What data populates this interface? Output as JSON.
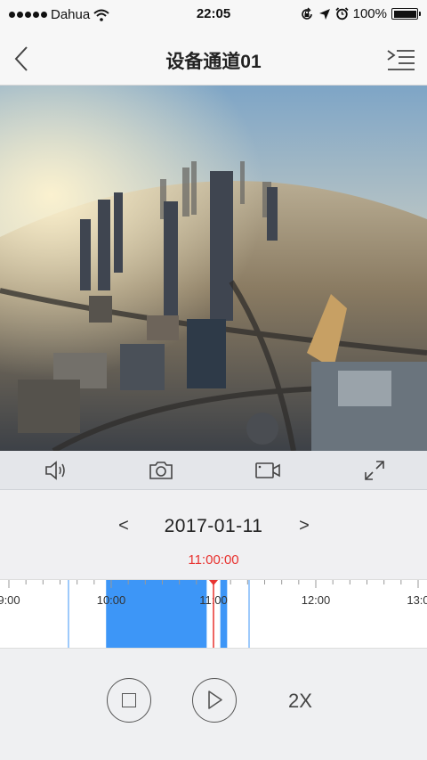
{
  "status_bar": {
    "carrier": "Dahua",
    "time": "22:05",
    "battery": "100%",
    "icons": [
      "signal-dots-icon",
      "wifi-icon",
      "rotation-lock-icon",
      "location-arrow-icon",
      "alarm-icon",
      "battery-icon"
    ]
  },
  "nav": {
    "title": "设备通道01",
    "icons": [
      "back-chevron-icon",
      "channel-list-icon"
    ]
  },
  "video": {
    "scene": "city-aerial-view"
  },
  "controls": {
    "icons": [
      "speaker-icon",
      "camera-icon",
      "record-video-icon",
      "fullscreen-icon"
    ]
  },
  "date": {
    "prev": "<",
    "value": "2017-01-11",
    "next": ">"
  },
  "timeline": {
    "current_time": "11:00:00",
    "labels": [
      "9:00",
      "10:00",
      "11:00",
      "12:00",
      "13:0"
    ],
    "recordings": [
      {
        "start": "09:57",
        "end": "10:56"
      },
      {
        "start": "11:04",
        "end": "11:08"
      }
    ],
    "marker_color": "#e8322f",
    "recording_color": "#3d96f7"
  },
  "playback": {
    "speed": "2X",
    "icons": [
      "stop-icon",
      "play-icon"
    ]
  }
}
